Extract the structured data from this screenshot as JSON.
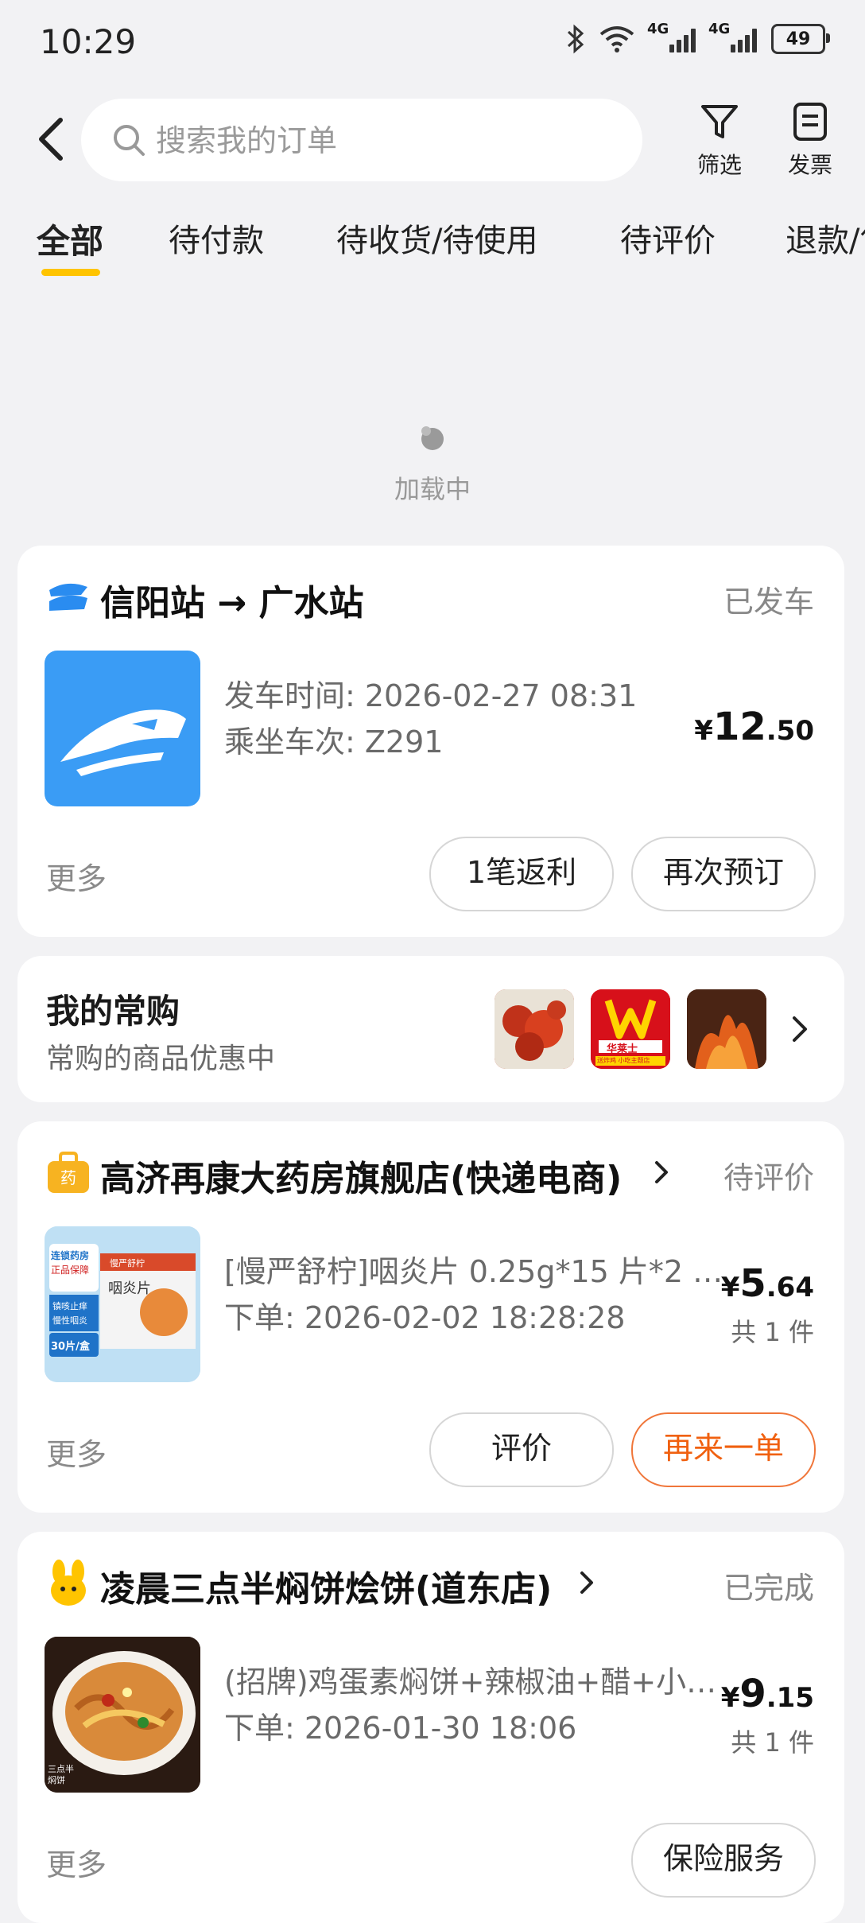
{
  "status_bar": {
    "time": "10:29",
    "net1": "4G",
    "net2": "4G",
    "battery": "49"
  },
  "search": {
    "placeholder": "搜索我的订单"
  },
  "header": {
    "filter_label": "筛选",
    "invoice_label": "发票"
  },
  "tabs": [
    {
      "label": "全部",
      "active": true
    },
    {
      "label": "待付款"
    },
    {
      "label": "待收货/待使用"
    },
    {
      "label": "待评价"
    },
    {
      "label": "退款/售后"
    }
  ],
  "loading": {
    "text": "加载中"
  },
  "orders": [
    {
      "title": "信阳站 → 广水站",
      "status": "已发车",
      "lines": [
        "发车时间: 2026-02-27 08:31",
        "乘坐车次: Z291"
      ],
      "price": {
        "currency": "¥",
        "integer": "12",
        "decimal": ".50"
      },
      "more": "更多",
      "buttons": [
        "1笔返利",
        "再次预订"
      ]
    },
    {
      "title": "高济再康大药房旗舰店(快递电商)",
      "status": "待评价",
      "lines": [
        "[慢严舒柠]咽炎片 0.25g*15 片*2 …",
        "下单: 2026-02-02 18:28:28"
      ],
      "price": {
        "currency": "¥",
        "integer": "5",
        "decimal": ".64"
      },
      "count": "共 1 件",
      "more": "更多",
      "buttons": [
        "评价",
        "再来一单"
      ],
      "product_label": {
        "line1": "连锁药房",
        "line2": "正品保障",
        "line3": "镇咳止痒",
        "line4": "慢性咽炎",
        "line5": "30片/盒",
        "box": "咽炎片",
        "box_brand": "慢严舒柠"
      }
    },
    {
      "title": "凌晨三点半焖饼烩饼(道东店)",
      "status": "已完成",
      "lines": [
        "(招牌)鸡蛋素焖饼+辣椒油+醋+小…",
        "下单: 2026-01-30 18:06"
      ],
      "price": {
        "currency": "¥",
        "integer": "9",
        "decimal": ".15"
      },
      "count": "共 1 件",
      "more": "更多",
      "buttons": [
        "保险服务"
      ],
      "thumb_text": "三点半 焖饼"
    }
  ],
  "favorites": {
    "title": "我的常购",
    "subtitle": "常购的商品优惠中",
    "logo_text": "华莱士",
    "logo_sub": "送炸鸡 小吃主题店"
  },
  "colors": {
    "accent": "#ffc400",
    "orange": "#f0600f",
    "train_blue": "#3a9cf5"
  }
}
